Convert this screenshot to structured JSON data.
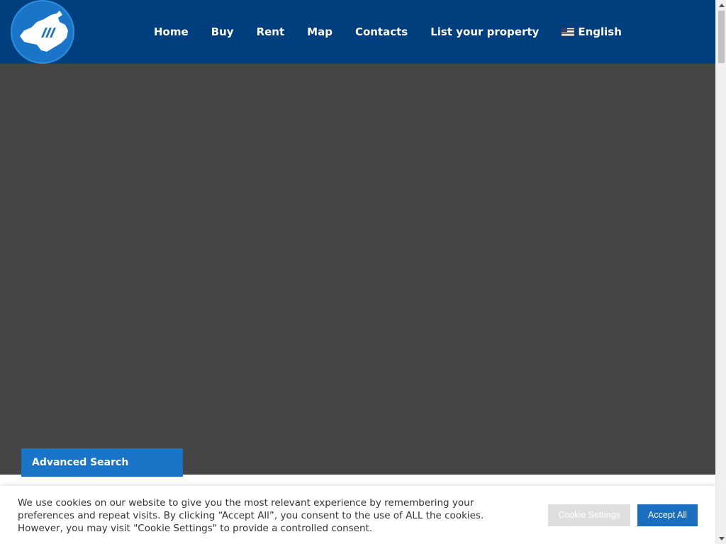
{
  "colors": {
    "header_bg": "#003f7d",
    "accent": "#1a75c9",
    "hero_bg": "#454545",
    "cookie_settings_bg": "#dedede",
    "accept_bg": "#1a6ebf"
  },
  "header": {
    "logo_icon": "mallorca-island-logo",
    "nav": [
      {
        "label": "Home"
      },
      {
        "label": "Buy"
      },
      {
        "label": "Rent"
      },
      {
        "label": "Map"
      },
      {
        "label": "Contacts"
      },
      {
        "label": "List your property"
      }
    ],
    "language": {
      "label": "English",
      "icon": "us-flag-icon"
    }
  },
  "hero": {
    "advanced_search_label": "Advanced Search"
  },
  "cookie_banner": {
    "text": "We use cookies on our website to give you the most relevant experience by remembering your preferences and repeat visits. By clicking “Accept All”, you consent to the use of ALL the cookies. However, you may visit \"Cookie Settings\" to provide a controlled consent.",
    "settings_label": "Cookie Settings",
    "accept_label": "Accept All"
  }
}
